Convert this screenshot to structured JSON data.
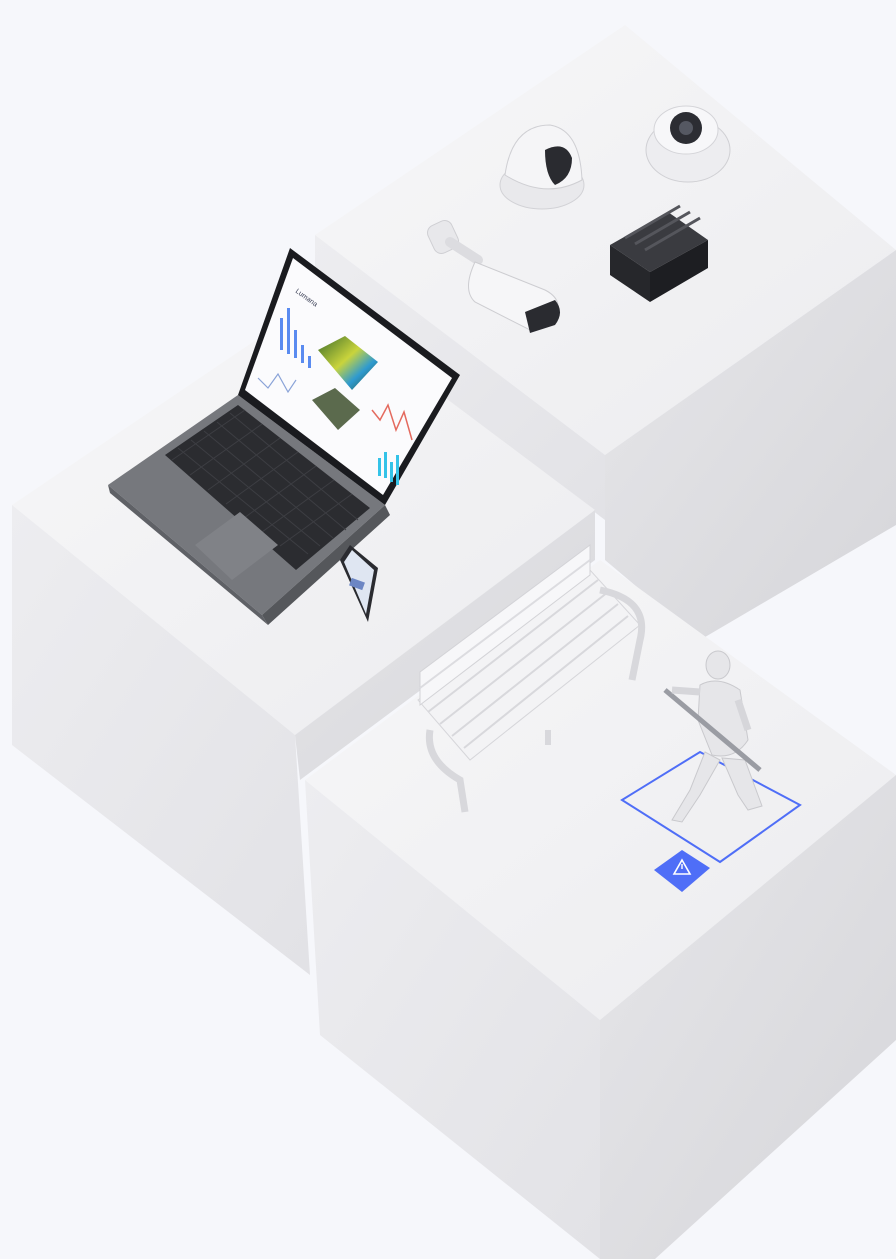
{
  "scene": {
    "laptop_brand": "Lumana",
    "alert_icon": "warning-triangle-icon",
    "colors": {
      "background": "#f6f7fb",
      "block_top": "#f1f1f3",
      "block_left": "#e7e7ea",
      "block_right": "#dcdcdf",
      "accent": "#4f6ef7",
      "laptop_body": "#6e7075",
      "chart_blue": "#5a8bf0",
      "chart_cyan": "#34c3e8",
      "chart_red": "#e46a5e"
    }
  }
}
